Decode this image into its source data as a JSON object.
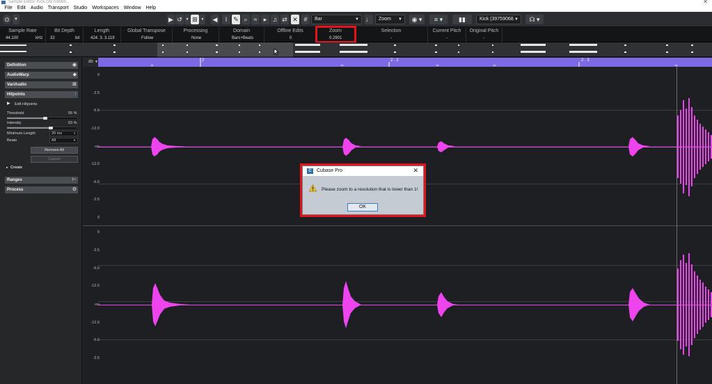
{
  "window": {
    "title": "Sample Editor: Kick (39759068...",
    "close_glyph": "✕"
  },
  "menu": [
    "File",
    "Edit",
    "Audio",
    "Transport",
    "Studio",
    "Workspaces",
    "Window",
    "Help"
  ],
  "toolbar": {
    "grid_type": "Bar",
    "zoom_mode": "Zoom",
    "event_name": "Kick (39759068."
  },
  "infoline": {
    "sample_rate": {
      "label": "Sample Rate",
      "value": "44.100",
      "unit": "kHz"
    },
    "bit_depth": {
      "label": "Bit Depth",
      "value": "32",
      "unit": "bit"
    },
    "length": {
      "label": "Length",
      "value": "424. 3. 3.119"
    },
    "global_transpose": {
      "label": "Global Transpose",
      "value": "Follow"
    },
    "processing": {
      "label": "Processing",
      "value": "None"
    },
    "domain": {
      "label": "Domain",
      "value": "Bars+Beats"
    },
    "offline_edits": {
      "label": "Offline Edits",
      "value": "0"
    },
    "zoom": {
      "label": "Zoom",
      "value": "0.2901"
    },
    "selection": {
      "label": "Selection",
      "value": "-"
    },
    "current_pitch": {
      "label": "Current Pitch",
      "value": "-"
    },
    "original_pitch": {
      "label": "Original Pitch",
      "value": "-"
    }
  },
  "inspector": {
    "sections": {
      "definition": "Definition",
      "audiowarp": "AudioWarp",
      "variaudio": "VariAudio",
      "hitpoints": "Hitpoints",
      "ranges": "Ranges",
      "process": "Process"
    },
    "edit_hitpoints": "Edit Hitpoints",
    "threshold": {
      "label": "Threshold",
      "value": "55 %",
      "level": 0.55
    },
    "intensity": {
      "label": "Intensity",
      "value": "63 %",
      "level": 0.63
    },
    "minimum_length": {
      "label": "Minimum Length",
      "value": "20 ms"
    },
    "beats": {
      "label": "Beats",
      "value": "All"
    },
    "remove_all": "Remove All",
    "cancel": "Cancel",
    "create": "Create"
  },
  "ruler": {
    "unit": "db",
    "labels": [
      "2",
      "2 . 2",
      "2 . 3"
    ]
  },
  "scale": {
    "channel1": [
      "0",
      "-2.5",
      "-6.0",
      "-12.0",
      "-oo",
      "-12.0",
      "-6.0",
      "-2.5",
      "0"
    ],
    "channel2": [
      "0",
      "-2.5",
      "-6.0",
      "-12.0",
      "-oo",
      "-12.0",
      "-6.0",
      "-2.5"
    ]
  },
  "dialog": {
    "title": "Cubase Pro",
    "message": "Please zoom to a resolution that is lower than 1!",
    "ok_label": "OK",
    "close_glyph": "✕",
    "app_glyph": "C"
  },
  "colors": {
    "waveform": "#ee44ee",
    "ruler": "#7c69e3",
    "highlight": "#e3141b"
  }
}
